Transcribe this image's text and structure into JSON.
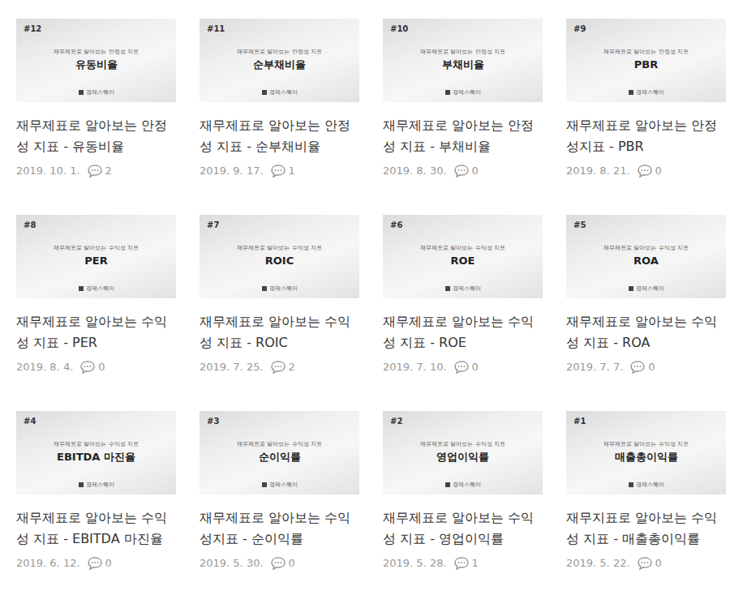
{
  "posts": [
    {
      "number": "#12",
      "thumb_subtitle": "재무제표로 알아보는 안정성 지표",
      "thumb_label": "유동비율",
      "brand": "경제스퀘어",
      "title": "재무제표로 알아보는 안정성 지표 - 유동비율",
      "date": "2019. 10. 1.",
      "comments": "2"
    },
    {
      "number": "#11",
      "thumb_subtitle": "재무제표로 알아보는 안정성 지표",
      "thumb_label": "순부채비율",
      "brand": "경제스퀘어",
      "title": "재무제표로 알아보는 안정성 지표 - 순부채비율",
      "date": "2019. 9. 17.",
      "comments": "1"
    },
    {
      "number": "#10",
      "thumb_subtitle": "재무제표로 알아보는 안정성 지표",
      "thumb_label": "부채비율",
      "brand": "경제스퀘어",
      "title": "재무제표로 알아보는 안정성 지표 - 부채비율",
      "date": "2019. 8. 30.",
      "comments": "0"
    },
    {
      "number": "#9",
      "thumb_subtitle": "재무제표로 알아보는 안정성 지표",
      "thumb_label": "PBR",
      "brand": "경제스퀘어",
      "title": "재무제표로 알아보는 안정성지표 - PBR",
      "date": "2019. 8. 21.",
      "comments": "0"
    },
    {
      "number": "#8",
      "thumb_subtitle": "재무제표로 알아보는 수익성 지표",
      "thumb_label": "PER",
      "brand": "경제스퀘어",
      "title": "재무제표로 알아보는 수익성 지표 - PER",
      "date": "2019. 8. 4.",
      "comments": "0"
    },
    {
      "number": "#7",
      "thumb_subtitle": "재무제표로 알아보는 수익성 지표",
      "thumb_label": "ROIC",
      "brand": "경제스퀘어",
      "title": "재무제표로 알아보는 수익성 지표 - ROIC",
      "date": "2019. 7. 25.",
      "comments": "2"
    },
    {
      "number": "#6",
      "thumb_subtitle": "재무제표로 알아보는 수익성 지표",
      "thumb_label": "ROE",
      "brand": "경제스퀘어",
      "title": "재무제표로 알아보는 수익성 지표 - ROE",
      "date": "2019. 7. 10.",
      "comments": "0"
    },
    {
      "number": "#5",
      "thumb_subtitle": "재무제표로 알아보는 수익성 지표",
      "thumb_label": "ROA",
      "brand": "경제스퀘어",
      "title": "재무제표로 알아보는 수익성 지표 - ROA",
      "date": "2019. 7. 7.",
      "comments": "0"
    },
    {
      "number": "#4",
      "thumb_subtitle": "재무제표로 알아보는 수익성 지표",
      "thumb_label": "EBITDA 마진율",
      "brand": "경제스퀘어",
      "title": "재무제표로 알아보는 수익성 지표 - EBITDA 마진율",
      "date": "2019. 6. 12.",
      "comments": "0"
    },
    {
      "number": "#3",
      "thumb_subtitle": "재무제표로 알아보는 수익성 지표",
      "thumb_label": "순이익률",
      "brand": "경제스퀘어",
      "title": "재무제표로 알아보는 수익성지표 - 순이익률",
      "date": "2019. 5. 30.",
      "comments": "0"
    },
    {
      "number": "#2",
      "thumb_subtitle": "재무제표로 알아보는 수익성 지표",
      "thumb_label": "영업이익률",
      "brand": "경제스퀘어",
      "title": "재무제표로 알아보는 수익성 지표 - 영업이익률",
      "date": "2019. 5. 28.",
      "comments": "1"
    },
    {
      "number": "#1",
      "thumb_subtitle": "재무제표로 알아보는 수익성 지표",
      "thumb_label": "매출총이익률",
      "brand": "경제스퀘어",
      "title": "재무지표로 알아보는 수익성 지표 - 매출총이익률",
      "date": "2019. 5. 22.",
      "comments": "0"
    }
  ]
}
